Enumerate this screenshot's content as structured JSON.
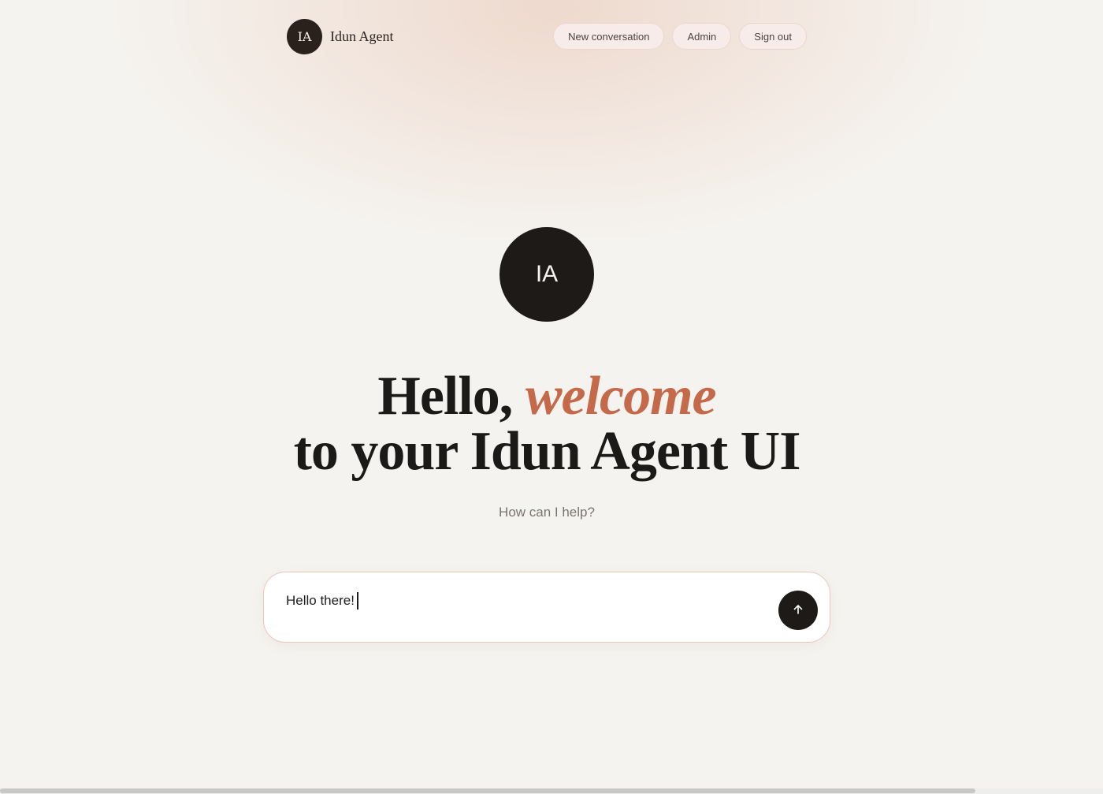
{
  "header": {
    "logo_initials": "IA",
    "app_name": "Idun Agent",
    "nav": [
      {
        "label": "New conversation"
      },
      {
        "label": "Admin"
      },
      {
        "label": "Sign out"
      }
    ]
  },
  "hero": {
    "avatar_initials": "IA",
    "headline_part1": "Hello,",
    "headline_accent": "welcome",
    "headline_line2": "to your Idun Agent UI",
    "subtitle": "How can I help?"
  },
  "composer": {
    "value": "Hello there!",
    "send_icon": "arrow-up-icon"
  },
  "colors": {
    "accent": "#c46a4a",
    "dark": "#1d1a18",
    "background": "#f5f3ef"
  }
}
